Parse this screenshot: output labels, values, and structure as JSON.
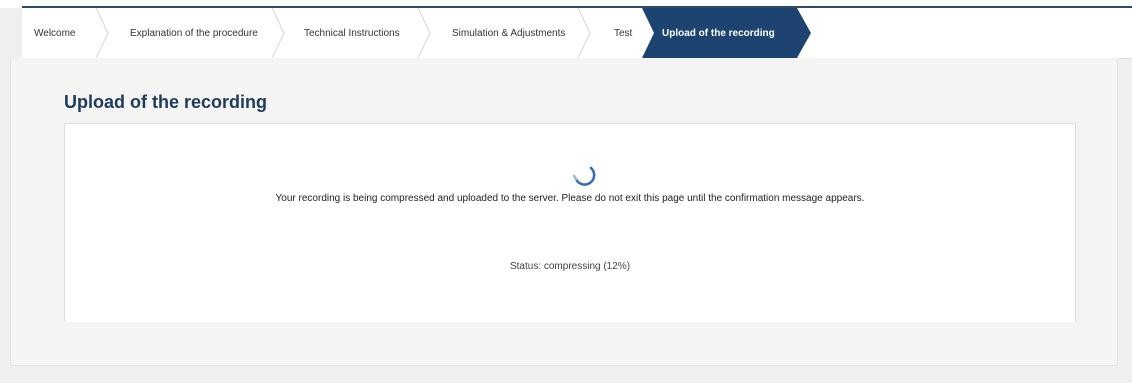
{
  "wizard": {
    "steps": [
      {
        "label": "Welcome",
        "active": false
      },
      {
        "label": "Explanation of the procedure",
        "active": false
      },
      {
        "label": "Technical Instructions",
        "active": false
      },
      {
        "label": "Simulation & Adjustments",
        "active": false
      },
      {
        "label": "Test",
        "active": false
      },
      {
        "label": "Upload of the recording",
        "active": true
      }
    ]
  },
  "main": {
    "title": "Upload of the recording",
    "spinner_icon": "loading-spinner-icon",
    "message": "Your recording is being compressed and uploaded to the server. Please do not exit this page until the confirmation message appears.",
    "status_text": "Status: compressing (12%)"
  },
  "colors": {
    "active_step": "#1d4470",
    "title": "#1d3b5a",
    "spinner": "#3a6fb0"
  }
}
